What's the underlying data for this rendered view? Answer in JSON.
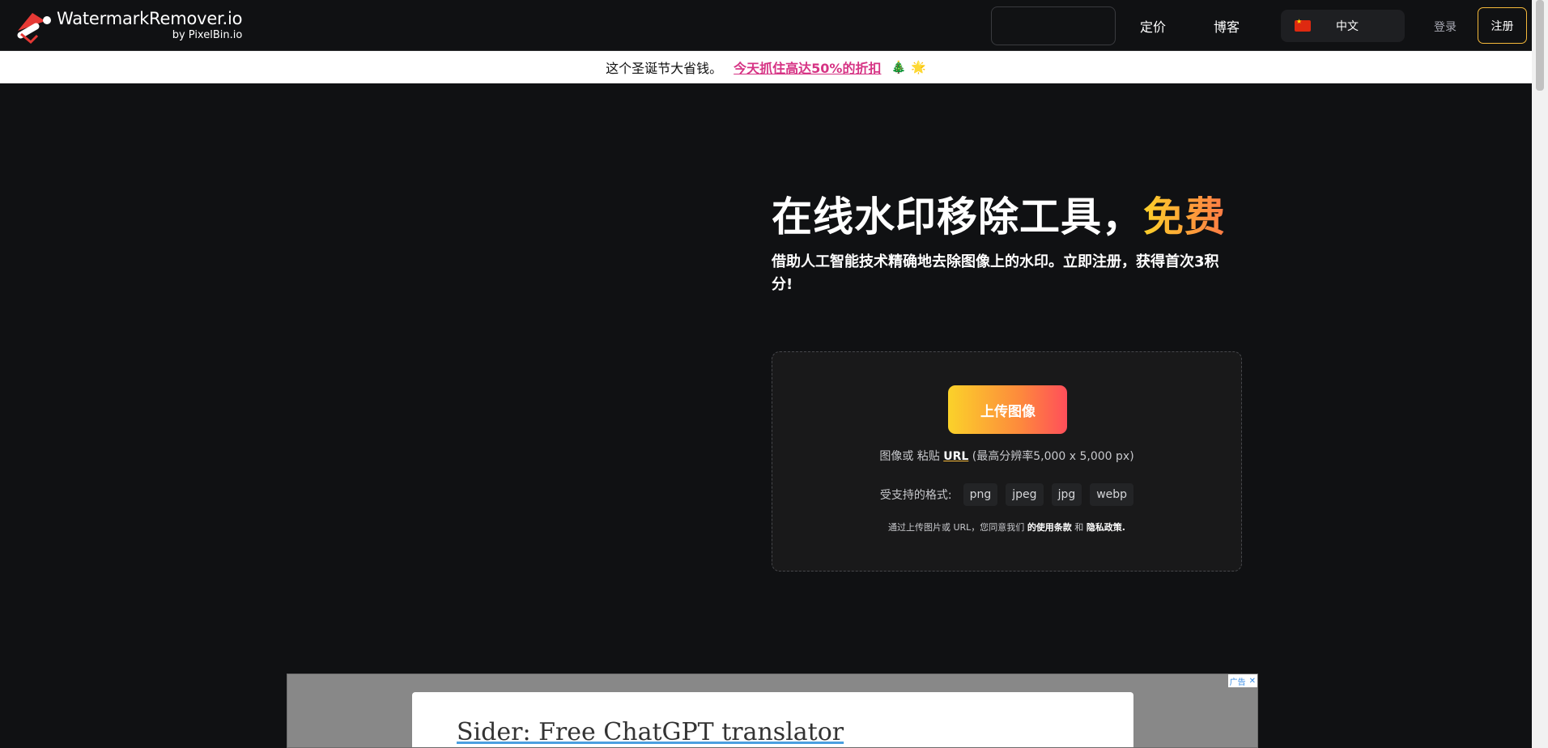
{
  "header": {
    "logo_title": "WatermarkRemover.io",
    "logo_sub": "by PixelBin.io",
    "nav": {
      "pricing": "定价",
      "blog": "博客"
    },
    "language": "中文",
    "login": "登录",
    "signup": "注册"
  },
  "promo": {
    "text": "这个圣诞节大省钱。",
    "link": "今天抓住高达50%的折扣",
    "emoji_tree": "🎄",
    "emoji_sparkle": "🌟"
  },
  "hero": {
    "title": "在线水印移除工具，",
    "title_accent": "免费",
    "subtitle": "借助人工智能技术精确地去除图像上的水印。立即注册，获得首次3积分!"
  },
  "upload": {
    "button": "上传图像",
    "hint_prefix": "图像或 粘贴 ",
    "hint_url": "URL",
    "hint_suffix": " (最高分辨率5,000 x 5,000 px)",
    "formats_label": "受支持的格式:",
    "formats": [
      "png",
      "jpeg",
      "jpg",
      "webp"
    ],
    "terms_prefix": "通过上传图片或 URL，您同意我们 ",
    "terms_link": "的使用条款",
    "terms_and": " 和 ",
    "privacy_link": "隐私政策."
  },
  "ad": {
    "title": "Sider: Free ChatGPT translator",
    "badge": "广告",
    "close": "✕"
  },
  "colors": {
    "background": "#101113",
    "accent_yellow": "#fbd02a",
    "accent_orange": "#ff7a45",
    "promo_link": "#d63384"
  }
}
